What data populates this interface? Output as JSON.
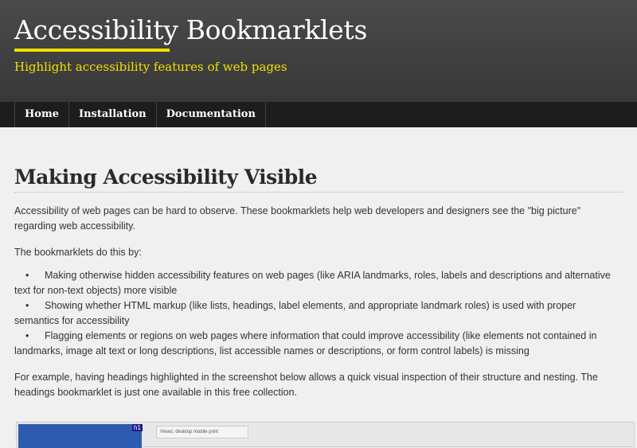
{
  "header": {
    "title": "Accessibility Bookmarklets",
    "tagline": "Highlight accessibility features of web pages"
  },
  "nav": {
    "items": [
      "Home",
      "Installation",
      "Documentation"
    ]
  },
  "main": {
    "heading": "Making Accessibility Visible",
    "intro": "Accessibility of web pages can be hard to observe. These bookmarklets help web developers and designers see the \"big picture\" regarding web accessibility.",
    "lead": "The bookmarklets do this by:",
    "bullets": [
      "Making otherwise hidden accessibility features on web pages (like ARIA landmarks, roles, labels and descriptions and alternative text for non-text objects) more visible",
      "Showing whether HTML markup (like lists, headings, label elements, and appropriate landmark roles) is used with proper semantics for accessibility",
      "Flagging elements or regions on web pages where information that could improve accessibility (like elements not contained in landmarks, image alt text or long descriptions, list accessible names or descriptions, or form control labels) is missing"
    ],
    "example": "For example, having headings highlighted in the screenshot below allows a quick visual inspection of their structure and nesting. The headings bookmarklet is just one available in this free collection.",
    "bullet_glyph": "•"
  },
  "screenshot": {
    "badge": "h1",
    "views_label": "Views:  desktop  mobile  print"
  }
}
